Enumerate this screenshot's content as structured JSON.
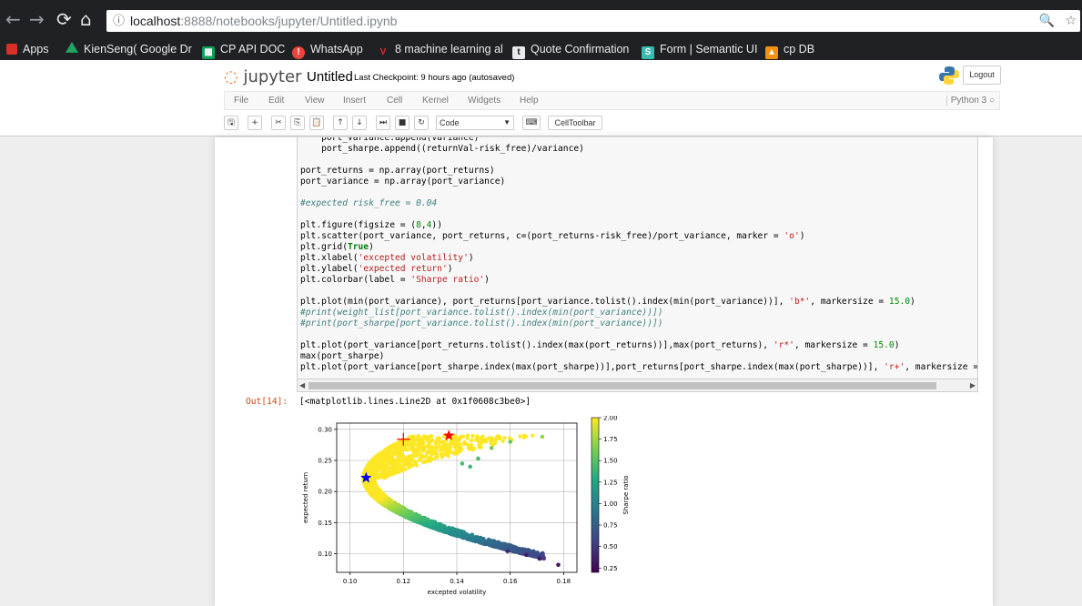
{
  "browser": {
    "back": "←",
    "forward": "→",
    "reload": "⟳",
    "home": "⌂",
    "info": "ⓘ",
    "url_host": "localhost",
    "url_rest": ":8888/notebooks/jupyter/Untitled.ipynb",
    "zoom": "🔍",
    "star": "☆"
  },
  "bookmarks": [
    {
      "label": "Apps",
      "icon": "apps-grid-icon",
      "color": "#e8eaed"
    },
    {
      "label": "KienSeng( Google Dr",
      "icon": "google-drive-icon",
      "color": "#1fa463"
    },
    {
      "label": "CP API DOC",
      "icon": "google-sheets-icon",
      "color": "#0f9d58"
    },
    {
      "label": "WhatsApp",
      "icon": "whatsapp-icon",
      "color": "#e8453c"
    },
    {
      "label": "8 machine learning al",
      "icon": "va-icon",
      "color": "#d93025"
    },
    {
      "label": "Quote Confirmation",
      "icon": "trello-icon",
      "color": "#e8eaed"
    },
    {
      "label": "Form | Semantic UI",
      "icon": "semantic-ui-icon",
      "color": "#35bdb2"
    },
    {
      "label": "cp DB",
      "icon": "pma-icon",
      "color": "#f29111"
    }
  ],
  "jupyter": {
    "logo_text": "jupyter",
    "notebook_name": "Untitled",
    "checkpoint": "Last Checkpoint: 9 hours ago (autosaved)",
    "logout": "Logout",
    "menus": [
      "File",
      "Edit",
      "View",
      "Insert",
      "Cell",
      "Kernel",
      "Widgets",
      "Help"
    ],
    "kernel_status": "Python 3 ○",
    "cell_type": "Code",
    "celltoolbar": "CellToolbar",
    "toolbar_icons": [
      {
        "name": "save-icon",
        "glyph": "🖫"
      },
      {
        "name": "insert-cell-icon",
        "glyph": "+"
      },
      {
        "name": "cut-icon",
        "glyph": "✂"
      },
      {
        "name": "copy-icon",
        "glyph": "⎘"
      },
      {
        "name": "paste-icon",
        "glyph": "📋"
      },
      {
        "name": "move-up-icon",
        "glyph": "↑"
      },
      {
        "name": "move-down-icon",
        "glyph": "↓"
      },
      {
        "name": "run-icon",
        "glyph": "⏭"
      },
      {
        "name": "stop-icon",
        "glyph": "■"
      },
      {
        "name": "restart-icon",
        "glyph": "↻"
      }
    ],
    "keyboard_icon": "⌨"
  },
  "code_lines": [
    [
      {
        "t": "    port_variance.append(variance)"
      }
    ],
    [
      {
        "t": "    port_sharpe.append((returnVal-risk_free)/variance)"
      }
    ],
    [
      {
        "t": ""
      }
    ],
    [
      {
        "t": "port_returns = np.array(port_returns)"
      }
    ],
    [
      {
        "t": "port_variance = np.array(port_variance)"
      }
    ],
    [
      {
        "t": ""
      }
    ],
    [
      {
        "t": "#expected risk_free = 0.04",
        "c": "cm"
      }
    ],
    [
      {
        "t": ""
      }
    ],
    [
      {
        "t": "plt.figure(figsize = ("
      },
      {
        "t": "8",
        "c": "nm"
      },
      {
        "t": ","
      },
      {
        "t": "4",
        "c": "nm"
      },
      {
        "t": "))"
      }
    ],
    [
      {
        "t": "plt.scatter(port_variance, port_returns, c=(port_returns-risk_free)/port_variance, marker = "
      },
      {
        "t": "'o'",
        "c": "st"
      },
      {
        "t": ")"
      }
    ],
    [
      {
        "t": "plt.grid("
      },
      {
        "t": "True",
        "c": "kw"
      },
      {
        "t": ")"
      }
    ],
    [
      {
        "t": "plt.xlabel("
      },
      {
        "t": "'excepted volatility'",
        "c": "st"
      },
      {
        "t": ")"
      }
    ],
    [
      {
        "t": "plt.ylabel("
      },
      {
        "t": "'expected return'",
        "c": "st"
      },
      {
        "t": ")"
      }
    ],
    [
      {
        "t": "plt.colorbar(label = "
      },
      {
        "t": "'Sharpe ratio'",
        "c": "st"
      },
      {
        "t": ")"
      }
    ],
    [
      {
        "t": ""
      }
    ],
    [
      {
        "t": "plt.plot(min(port_variance), port_returns[port_variance.tolist().index(min(port_variance))], "
      },
      {
        "t": "'b*'",
        "c": "st"
      },
      {
        "t": ", markersize = "
      },
      {
        "t": "15.0",
        "c": "nm"
      },
      {
        "t": ")"
      }
    ],
    [
      {
        "t": "#print(weight_list[port_variance.tolist().index(min(port_variance))])",
        "c": "cm"
      }
    ],
    [
      {
        "t": "#print(port_sharpe[port_variance.tolist().index(min(port_variance))])",
        "c": "cm"
      }
    ],
    [
      {
        "t": ""
      }
    ],
    [
      {
        "t": "plt.plot(port_variance[port_returns.tolist().index(max(port_returns))],max(port_returns), "
      },
      {
        "t": "'r*'",
        "c": "st"
      },
      {
        "t": ", markersize = "
      },
      {
        "t": "15.0",
        "c": "nm"
      },
      {
        "t": ")"
      }
    ],
    [
      {
        "t": "max(port_sharpe)"
      }
    ],
    [
      {
        "t": "plt.plot(port_variance[port_sharpe.index(max(port_sharpe))],port_returns[port_sharpe.index(max(port_sharpe))], "
      },
      {
        "t": "'r+'",
        "c": "st"
      },
      {
        "t": ", markersize ="
      }
    ]
  ],
  "output": {
    "prompt": "Out[14]:",
    "text": "[<matplotlib.lines.Line2D at 0x1f0608c3be0>]"
  },
  "chart_data": {
    "type": "scatter",
    "xlabel": "excepted volatility",
    "ylabel": "expected return",
    "colorbar_label": "Sharpe ratio",
    "xlim": [
      0.095,
      0.185
    ],
    "ylim": [
      0.07,
      0.31
    ],
    "xticks": [
      "0.10",
      "0.12",
      "0.14",
      "0.16",
      "0.18"
    ],
    "yticks": [
      "0.10",
      "0.15",
      "0.20",
      "0.25",
      "0.30"
    ],
    "colorbar_range": [
      0.2,
      2.0
    ],
    "colorbar_ticks": [
      "2.00",
      "1.75",
      "1.50",
      "1.25",
      "1.00",
      "0.75",
      "0.50",
      "0.25"
    ],
    "grid": true,
    "colormap": [
      "#440154",
      "#414487",
      "#2a788e",
      "#22a884",
      "#7ad151",
      "#fde725"
    ],
    "frontier": {
      "min_vol": 0.105,
      "min_vol_return": 0.222,
      "max_return": 0.292
    },
    "outliers": [
      {
        "x": 0.172,
        "y": 0.288,
        "s": 1.72
      },
      {
        "x": 0.153,
        "y": 0.27,
        "s": 1.6
      },
      {
        "x": 0.16,
        "y": 0.28,
        "s": 1.55
      },
      {
        "x": 0.148,
        "y": 0.253,
        "s": 1.45
      },
      {
        "x": 0.142,
        "y": 0.245,
        "s": 1.45
      },
      {
        "x": 0.145,
        "y": 0.24,
        "s": 1.4
      },
      {
        "x": 0.166,
        "y": 0.098,
        "s": 0.35
      },
      {
        "x": 0.171,
        "y": 0.092,
        "s": 0.33
      },
      {
        "x": 0.178,
        "y": 0.082,
        "s": 0.3
      },
      {
        "x": 0.159,
        "y": 0.104,
        "s": 0.4
      }
    ],
    "markers": [
      {
        "label": "min variance",
        "x": 0.106,
        "y": 0.222,
        "symbol": "star",
        "color": "#0000ff"
      },
      {
        "label": "max return",
        "x": 0.137,
        "y": 0.29,
        "symbol": "star",
        "color": "#ff0000"
      },
      {
        "label": "max sharpe",
        "x": 0.12,
        "y": 0.284,
        "symbol": "plus",
        "color": "#ff0000"
      }
    ]
  }
}
